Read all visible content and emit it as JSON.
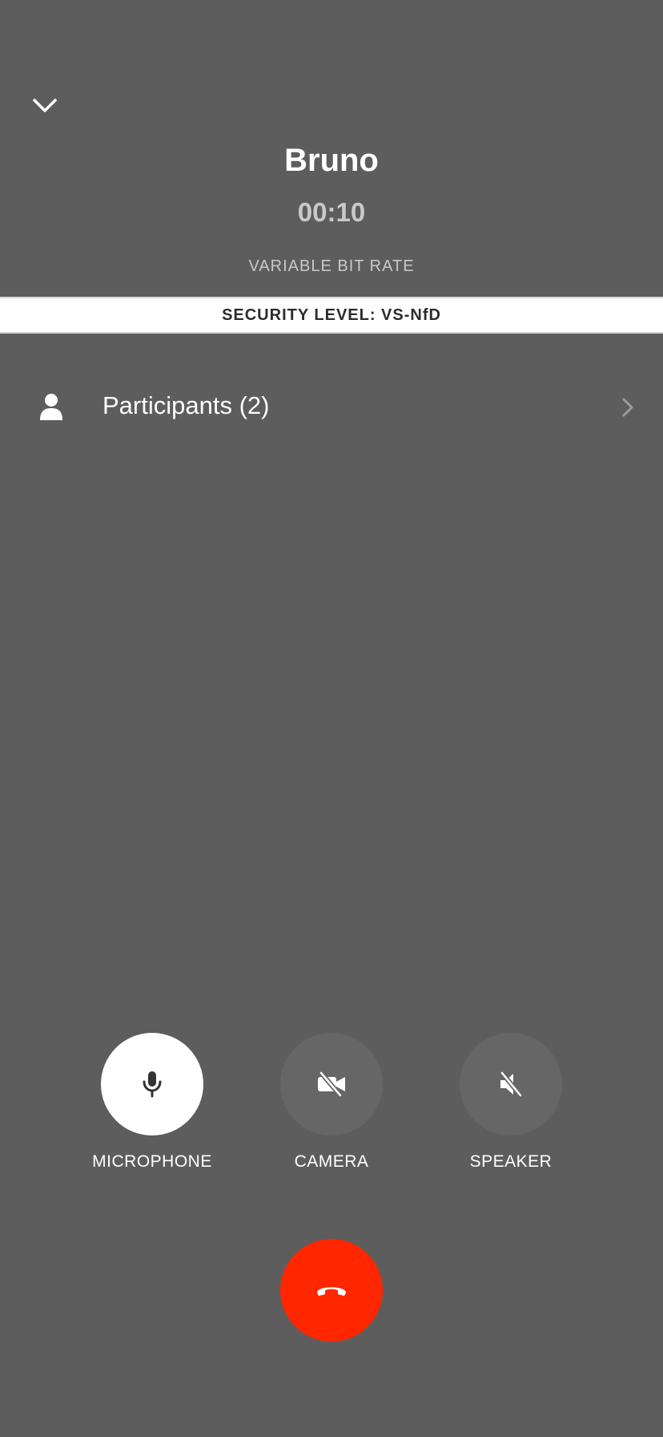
{
  "call": {
    "caller_name": "Bruno",
    "timer": "00:10",
    "bit_rate_label": "VARIABLE BIT RATE",
    "security_level": "SECURITY LEVEL: VS-NfD"
  },
  "participants": {
    "label": "Participants (2)",
    "icon": "person-icon"
  },
  "controls": [
    {
      "label": "MICROPHONE",
      "icon": "microphone-icon",
      "active": true
    },
    {
      "label": "CAMERA",
      "icon": "camera-off-icon",
      "active": false
    },
    {
      "label": "SPEAKER",
      "icon": "speaker-off-icon",
      "active": false
    }
  ],
  "hangup": {
    "icon": "hangup-phone-icon"
  },
  "colors": {
    "background": "#5d5d5d",
    "hangup": "#ff2600",
    "security_bar": "#ffffff"
  }
}
